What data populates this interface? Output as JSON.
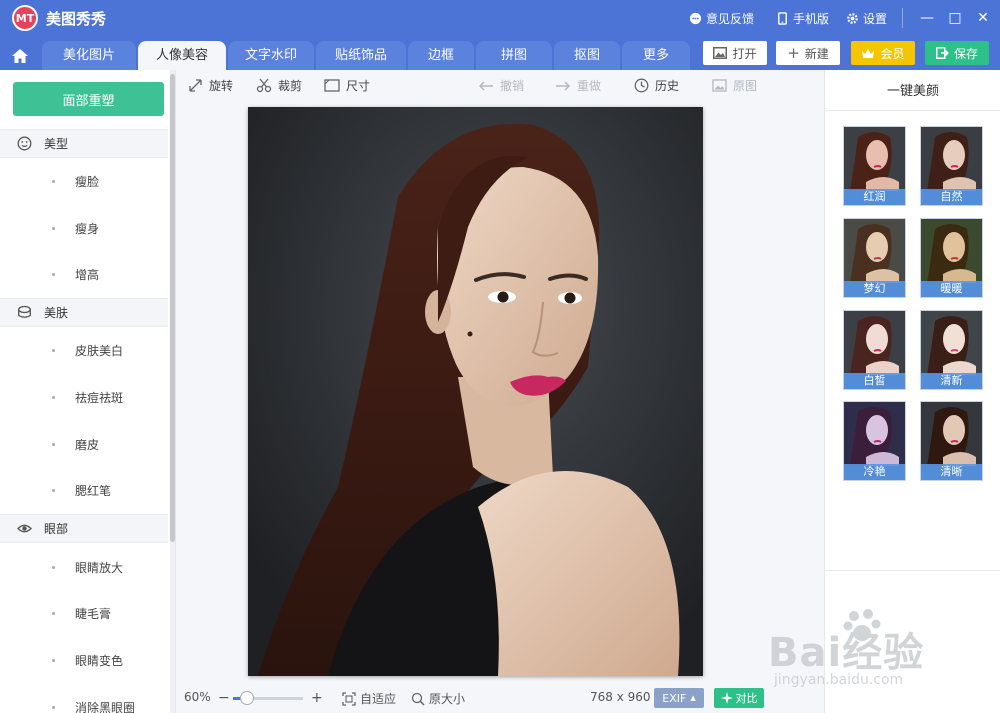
{
  "app": {
    "title": "美图秀秀",
    "logo_text": "MT"
  },
  "titlebar": {
    "feedback": "意见反馈",
    "mobile": "手机版",
    "settings": "设置",
    "minimize": "—",
    "maximize": "□",
    "close": "✕"
  },
  "tabs": [
    "美化图片",
    "人像美容",
    "文字水印",
    "贴纸饰品",
    "边框",
    "拼图",
    "抠图",
    "更多"
  ],
  "active_tab": "人像美容",
  "header_buttons": {
    "open": "打开",
    "new": "新建",
    "vip": "会员",
    "save": "保存"
  },
  "sidebar": {
    "primary_button": "面部重塑",
    "sections": [
      {
        "title": "美型",
        "icon": "face-icon",
        "items": [
          "瘦脸",
          "瘦身",
          "增高"
        ]
      },
      {
        "title": "美肤",
        "icon": "skin-icon",
        "items": [
          "皮肤美白",
          "祛痘祛斑",
          "磨皮",
          "腮红笔"
        ]
      },
      {
        "title": "眼部",
        "icon": "eye-icon",
        "items": [
          "眼睛放大",
          "睫毛膏",
          "眼睛变色",
          "消除黑眼圈"
        ]
      }
    ]
  },
  "toolbar": {
    "rotate": "旋转",
    "crop": "裁剪",
    "size": "尺寸",
    "undo": "撤销",
    "redo": "重做",
    "history": "历史",
    "original": "原图"
  },
  "bottombar": {
    "zoom": "60%",
    "zoom_minus": "−",
    "zoom_plus": "+",
    "zoom_level": 0.2,
    "fit": "自适应",
    "actual_size": "原大小",
    "dimensions": "768 x 960",
    "exif": "EXIF",
    "compare": "对比"
  },
  "right_panel": {
    "title": "一键美颜",
    "presets": [
      "红润",
      "自然",
      "梦幻",
      "暖暖",
      "白皙",
      "清新",
      "冷艳",
      "清晰"
    ]
  },
  "watermark": {
    "brand": "Bai经验",
    "url": "jingyan.baidu.com"
  },
  "colors": {
    "brand_blue": "#4b74d6",
    "green": "#2ec089",
    "gold": "#f5c500",
    "thumb_label": "#5696e8"
  }
}
